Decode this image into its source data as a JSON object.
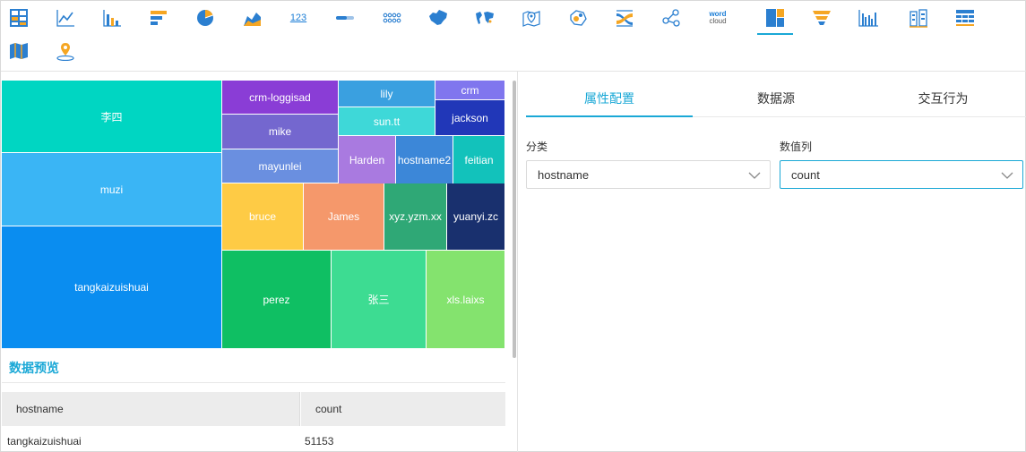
{
  "toolbar": {
    "items": [
      {
        "icon": "table-icon"
      },
      {
        "icon": "line-chart-icon"
      },
      {
        "icon": "bar-chart-icon"
      },
      {
        "icon": "horizontal-bar-icon"
      },
      {
        "icon": "pie-chart-icon"
      },
      {
        "icon": "area-chart-icon"
      },
      {
        "icon": "kpi-number-icon",
        "text": "123"
      },
      {
        "icon": "progress-bar-icon"
      },
      {
        "icon": "dots-grid-icon"
      },
      {
        "icon": "china-map-icon"
      },
      {
        "icon": "world-map-icon"
      },
      {
        "icon": "location-map-icon"
      },
      {
        "icon": "bubble-map-icon"
      },
      {
        "icon": "sankey-icon"
      },
      {
        "icon": "relation-graph-icon"
      },
      {
        "icon": "word-cloud-icon",
        "text1": "word",
        "text2": "cloud"
      },
      {
        "icon": "treemap-icon",
        "active": true
      },
      {
        "icon": "funnel-icon"
      },
      {
        "icon": "grouped-bar-icon"
      },
      {
        "icon": "building-bar-icon"
      },
      {
        "icon": "cross-table-icon"
      },
      {
        "icon": "color-map-icon"
      },
      {
        "icon": "pin-map-icon"
      }
    ],
    "active_color": "#1aa8d6"
  },
  "treemap": {
    "cells": [
      {
        "label": "李四",
        "color": "#00d6c2"
      },
      {
        "label": "muzi",
        "color": "#3ab5f5"
      },
      {
        "label": "tangkaizuishuai",
        "color": "#0a8df0"
      },
      {
        "label": "crm-loggisad",
        "color": "#8a3dd6"
      },
      {
        "label": "mike",
        "color": "#7467cf"
      },
      {
        "label": "mayunlei",
        "color": "#6a8fe0"
      },
      {
        "label": "lily",
        "color": "#3aa0e0"
      },
      {
        "label": "crm",
        "color": "#8076ee"
      },
      {
        "label": "sun.tt",
        "color": "#3ed8d8"
      },
      {
        "label": "jackson",
        "color": "#2137b8"
      },
      {
        "label": "Harden",
        "color": "#a97ae0"
      },
      {
        "label": "hostname2",
        "color": "#3c87d8"
      },
      {
        "label": "feitian",
        "color": "#12c2bb"
      },
      {
        "label": "bruce",
        "color": "#fecb45"
      },
      {
        "label": "James",
        "color": "#f5986b"
      },
      {
        "label": "xyz.yzm.xx",
        "color": "#2fa876"
      },
      {
        "label": "yuanyi.zc",
        "color": "#19306e"
      },
      {
        "label": "perez",
        "color": "#0fbf63"
      },
      {
        "label": "张三",
        "color": "#3ddc92"
      },
      {
        "label": "xls.laixs",
        "color": "#84e36e"
      }
    ]
  },
  "preview": {
    "title": "数据预览",
    "headers": [
      "hostname",
      "count"
    ],
    "rows": [
      [
        "tangkaizuishuai",
        "51153"
      ]
    ]
  },
  "config": {
    "tabs": [
      {
        "label": "属性配置",
        "active": true
      },
      {
        "label": "数据源"
      },
      {
        "label": "交互行为"
      }
    ],
    "category_label": "分类",
    "category_value": "hostname",
    "value_label": "数值列",
    "value_value": "count"
  }
}
